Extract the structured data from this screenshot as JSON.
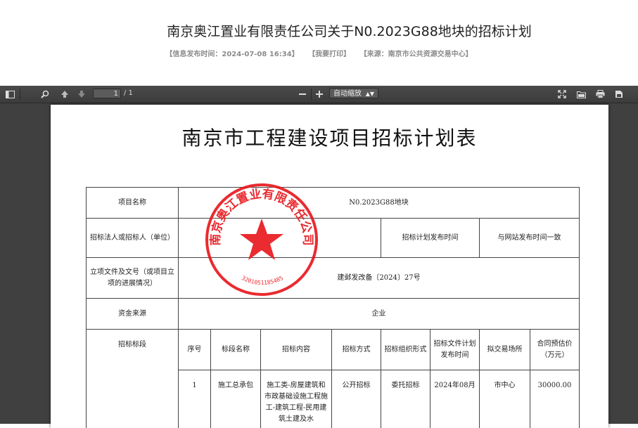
{
  "page": {
    "title": "南京奥江置业有限责任公司关于N0.2023G88地块的招标计划",
    "meta_time": "【信息发布时间：2024-07-08 16:34】",
    "meta_print": "【我要打印】",
    "meta_source": "【来源：南京市公共资源交易中心】"
  },
  "toolbar": {
    "page_current": "1",
    "page_total": "/ 1",
    "zoom_label": "自动缩放",
    "icons": [
      "sidebar-toggle-icon",
      "search-icon",
      "arrow-up-icon",
      "arrow-down-icon",
      "zoom-out-icon",
      "zoom-in-icon",
      "fullscreen-icon",
      "open-file-icon",
      "print-icon",
      "download-icon"
    ]
  },
  "document": {
    "title": "南京市工程建设项目招标计划表",
    "rows": {
      "project_name_label": "项目名称",
      "project_name_value": "N0.2023G88地块",
      "tenderer_label": "招标法人或招标人（单位）",
      "plan_publish_label": "招标计划发布时间",
      "plan_publish_value": "与网站发布时间一致",
      "approval_label": "立项文件及文号（或项目立项的进展情况）",
      "approval_value": "建邺发改备〔2024〕27号",
      "fund_label": "资金来源",
      "fund_value": "企业",
      "section_label": "招标标段"
    },
    "section_headers": [
      "序号",
      "标段名称",
      "招标内容",
      "招标方式",
      "招标组织形式",
      "招标文件计划发布时间",
      "拟交易场所",
      "合同预估价（万元）"
    ],
    "section_rows": [
      {
        "no": "1",
        "name": "施工总承包",
        "content": "施工类-房屋建筑和市政基础设施工程施工-建筑工程-民用建筑土建及水",
        "method": "公开招标",
        "org": "委托招标",
        "doc_time": "2024年08月",
        "venue": "市中心",
        "price": "30000.00"
      }
    ]
  },
  "seal": {
    "company": "南京奥江置业有限责任公司",
    "code": "3201051185485",
    "color": "#e8141a"
  }
}
